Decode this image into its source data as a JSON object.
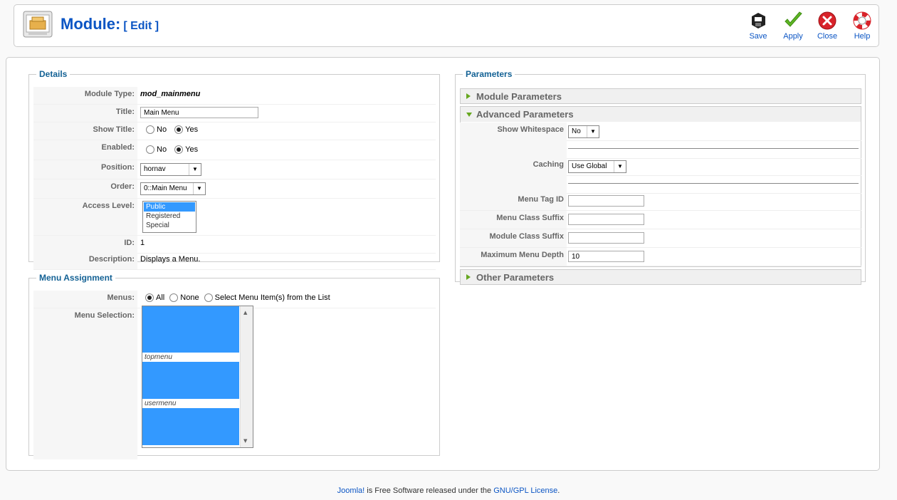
{
  "header": {
    "title": "Module:",
    "subtitle": "[ Edit ]"
  },
  "toolbar": {
    "save_label": "Save",
    "apply_label": "Apply",
    "close_label": "Close",
    "help_label": "Help"
  },
  "details": {
    "legend": "Details",
    "module_type_label": "Module Type:",
    "module_type_value": "mod_mainmenu",
    "title_label": "Title:",
    "title_value": "Main Menu",
    "show_title_label": "Show Title:",
    "enabled_label": "Enabled:",
    "no_label": "No",
    "yes_label": "Yes",
    "position_label": "Position:",
    "position_value": "hornav",
    "order_label": "Order:",
    "order_value": "0::Main Menu",
    "access_label": "Access Level:",
    "access_options": [
      "Public",
      "Registered",
      "Special"
    ],
    "id_label": "ID:",
    "id_value": "1",
    "description_label": "Description:",
    "description_value": "Displays a Menu."
  },
  "menu_assignment": {
    "legend": "Menu Assignment",
    "menus_label": "Menus:",
    "opt_all": "All",
    "opt_none": "None",
    "opt_select": "Select Menu Item(s) from the List",
    "selection_label": "Menu Selection:",
    "group_topmenu": "topmenu",
    "group_usermenu": "usermenu"
  },
  "parameters": {
    "legend": "Parameters",
    "module_params": "Module Parameters",
    "advanced_params": "Advanced Parameters",
    "other_params": "Other Parameters",
    "show_whitespace_label": "Show Whitespace",
    "show_whitespace_value": "No",
    "caching_label": "Caching",
    "caching_value": "Use Global",
    "menu_tag_id_label": "Menu Tag ID",
    "menu_class_suffix_label": "Menu Class Suffix",
    "module_class_suffix_label": "Module Class Suffix",
    "max_depth_label": "Maximum Menu Depth",
    "max_depth_value": "10"
  },
  "footer": {
    "joomla": "Joomla!",
    "text": " is Free Software released under the ",
    "license": "GNU/GPL License",
    "end": "."
  },
  "colors": {
    "accent": "#0b55c4",
    "legend": "#146295",
    "selection": "#3399ff"
  }
}
